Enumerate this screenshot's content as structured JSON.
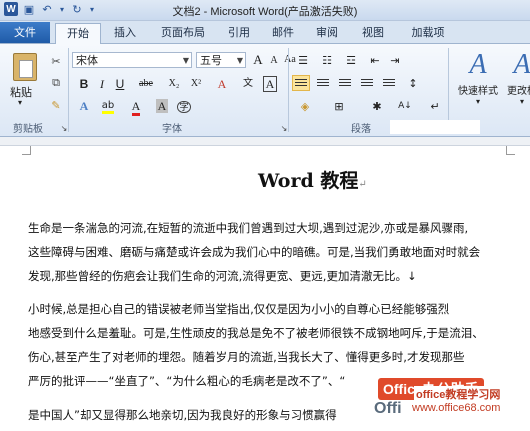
{
  "window": {
    "title": "文档2 - Microsoft Word(产品激活失败)"
  },
  "tabs": {
    "file": "文件",
    "items": [
      "开始",
      "插入",
      "页面布局",
      "引用",
      "邮件",
      "审阅",
      "视图",
      "加载项"
    ]
  },
  "ribbon": {
    "paste_label": "粘贴",
    "clipboard_group": "剪贴板",
    "font_group": "字体",
    "paragraph_group": "段落",
    "font_name": "宋体",
    "font_size": "五号",
    "quick_styles": "快速样式",
    "change_styles": "更改样",
    "bold": "B",
    "italic": "I",
    "underline": "U",
    "strikethrough": "abe",
    "subscript": "X₂",
    "superscript": "X²",
    "grow_font": "A",
    "shrink_font": "A",
    "change_case": "Aa",
    "clear_format": "A",
    "phonetic": "文",
    "char_border": "A",
    "font_color": "A",
    "char_shading": "A",
    "enclose_char": "字",
    "show_marks": "↵",
    "styles_letter": "A"
  },
  "document": {
    "title": "Word 教程",
    "lines": [
      "生命是一条湍急的河流,在短暂的流逝中我们曾遇到过大坝,遇到过泥沙,亦或是暴风骤雨,",
      "这些障碍与困难、磨砺与痛楚或许会成为我们心中的暗礁。可是,当我们勇敢地面对时就会",
      "发现,那些曾经的伤疤会让我们生命的河流,流得更宽、更远,更加清澈无比。↓",
      "    小时候,总是担心自己的错误被老师当堂指出,仅仅是因为小小的自尊心已经能够强烈",
      "地感受到什么是羞耻。可是,生性顽皮的我总是免不了被老师很铁不成钢地呵斥,于是流泪、",
      "伤心,甚至产生了对老师的埋怨。随着岁月的流逝,当我长大了、懂得更多时,才发现那些",
      "严厉的批评——“坐直了”、“为什么粗心的毛病老是改不了”、“",
      "是中国人”却又显得那么地亲切,因为我良好的形象与习惯赢得"
    ]
  },
  "watermark": {
    "badge": "Office办公助手",
    "brand": "Offi",
    "url": "www.office68.com",
    "site": "office教程学习网"
  }
}
